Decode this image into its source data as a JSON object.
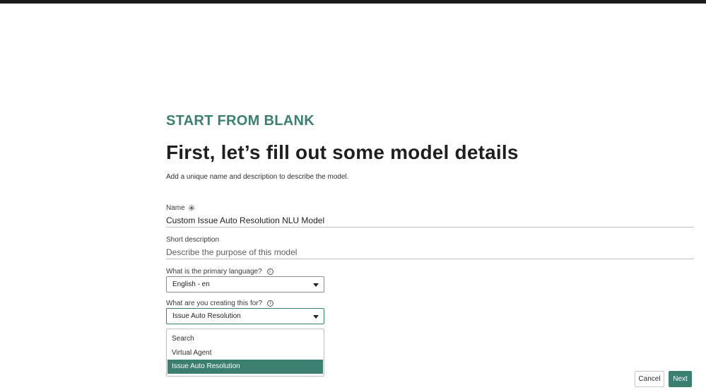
{
  "wizard": {
    "eyebrow": "START FROM BLANK",
    "title": "First, let’s fill out some model details",
    "subtitle": "Add a unique name and description to describe the model."
  },
  "form": {
    "name": {
      "label": "Name",
      "value": "Custom Issue Auto Resolution NLU Model",
      "required_icon": "✳"
    },
    "short_description": {
      "label": "Short description",
      "placeholder": "Describe the purpose of this model",
      "value": ""
    },
    "language": {
      "label": "What is the primary language?",
      "value": "English - en",
      "info_icon": "i"
    },
    "purpose": {
      "label": "What are you creating this for?",
      "value": "Issue Auto Resolution",
      "info_icon": "i",
      "options": [
        "Search",
        "Virtual Agent",
        "Issue Auto Resolution"
      ],
      "selected_index": 2
    }
  },
  "actions": {
    "cancel_label": "Cancel",
    "next_label": "Next"
  },
  "colors": {
    "accent": "#3b7f70",
    "heading": "#1f1f1f",
    "top_bar": "#1c1c1c"
  }
}
